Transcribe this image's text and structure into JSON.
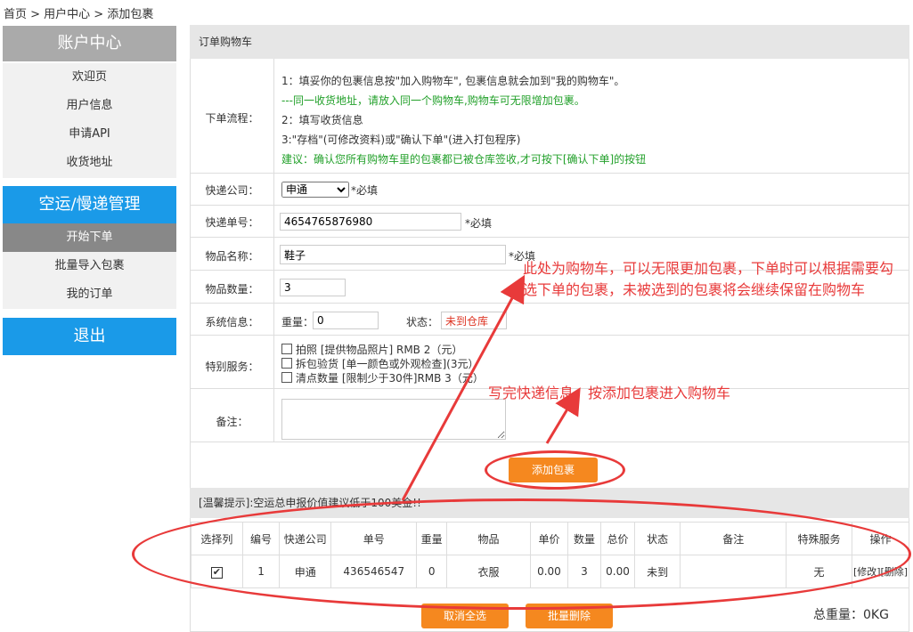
{
  "breadcrumb": "首页 > 用户中心 > 添加包裹",
  "sidebar": {
    "account_title": "账户中心",
    "account_items": [
      "欢迎页",
      "用户信息",
      "申请API",
      "收货地址"
    ],
    "shipping_title": "空运/慢递管理",
    "shipping_items": [
      "开始下单",
      "批量导入包裹",
      "我的订单"
    ],
    "logout": "退出"
  },
  "panel_title": "订单购物车",
  "process": {
    "label": "下单流程：",
    "lines": [
      "1：填妥你的包裹信息按\"加入购物车\", 包裹信息就会加到\"我的购物车\"。",
      "---同一收货地址，请放入同一个购物车,购物车可无限增加包裹。",
      "2：填写收货信息",
      "3:\"存档\"(可修改资料)或\"确认下单\"(进入打包程序)",
      "建议：确认您所有购物车里的包裹都已被仓库签收,才可按下[确认下单]的按钮"
    ]
  },
  "form": {
    "courier_label": "快递公司：",
    "courier_value": "申通",
    "required": "*必填",
    "tracking_label": "快递单号：",
    "tracking_value": "4654765876980",
    "item_label": "物品名称：",
    "item_value": "鞋子",
    "qty_label": "物品数量：",
    "qty_value": "3",
    "sys_label": "系统信息：",
    "weight_label": "重量：",
    "weight_value": "0",
    "status_label": "状态：",
    "status_value": "未到仓库",
    "special_label": "特别服务：",
    "special_items": [
      "拍照 [提供物品照片] RMB 2（元）",
      "拆包验货 [单一颜色或外观检查](3元）",
      "清点数量 [限制少于30件]RMB 3（元）"
    ],
    "note_label": "备注："
  },
  "add_button": "添加包裹",
  "tip": "[温馨提示]:空运总申报价值建议低于100美金!!",
  "table": {
    "headers": [
      "选择列",
      "编号",
      "快递公司",
      "单号",
      "重量",
      "物品",
      "单价",
      "数量",
      "总价",
      "状态",
      "备注",
      "特殊服务",
      "操作"
    ],
    "row": {
      "id": "1",
      "courier": "申通",
      "tracking": "436546547",
      "weight": "0",
      "item": "衣服",
      "unit_price": "0.00",
      "qty": "3",
      "total": "0.00",
      "status": "未到",
      "note": "",
      "special": "无",
      "ops": "[修改][删除]"
    }
  },
  "cancel_select": "取消全选",
  "batch_delete": "批量删除",
  "total_weight": "总重量：0KG",
  "annotations": {
    "cart": "此处为购物车，可以无限更加包裹，下单时可以根据需要勾选下单的包裹，未被选到的包裹将会继续保留在购物车",
    "add": "写完快递信息，按添加包裹进入购物车"
  },
  "colors": {
    "sidebar_head_gray": "#aaaaaa",
    "sidebar_head_blue": "#1a9ae8",
    "accent": "#f5881f",
    "annotation": "#e83a3a"
  }
}
